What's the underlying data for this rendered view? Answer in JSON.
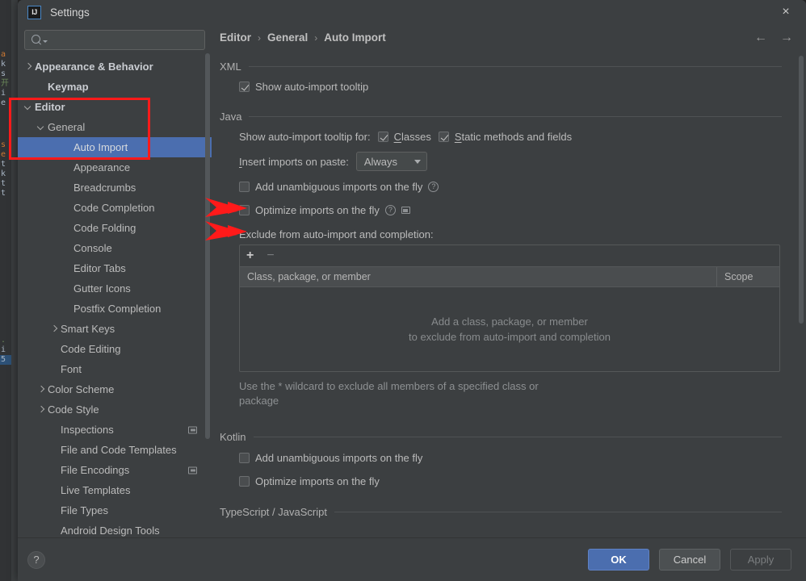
{
  "window": {
    "title": "Settings",
    "app_icon": "intellij-idea-icon",
    "close_icon": "×"
  },
  "search": {
    "value": "",
    "placeholder": "",
    "icon": "search-icon"
  },
  "sidebar": {
    "items": [
      {
        "label": "Appearance & Behavior",
        "indent": 0,
        "twisty": "right",
        "bold": true,
        "selected": false,
        "project_icon": false
      },
      {
        "label": "Keymap",
        "indent": 1,
        "twisty": "none",
        "bold": true,
        "selected": false,
        "project_icon": false
      },
      {
        "label": "Editor",
        "indent": 0,
        "twisty": "down",
        "bold": true,
        "selected": false,
        "project_icon": false
      },
      {
        "label": "General",
        "indent": 1,
        "twisty": "down",
        "bold": false,
        "selected": false,
        "project_icon": false
      },
      {
        "label": "Auto Import",
        "indent": 3,
        "twisty": "none",
        "bold": false,
        "selected": true,
        "project_icon": false
      },
      {
        "label": "Appearance",
        "indent": 3,
        "twisty": "none",
        "bold": false,
        "selected": false,
        "project_icon": false
      },
      {
        "label": "Breadcrumbs",
        "indent": 3,
        "twisty": "none",
        "bold": false,
        "selected": false,
        "project_icon": false
      },
      {
        "label": "Code Completion",
        "indent": 3,
        "twisty": "none",
        "bold": false,
        "selected": false,
        "project_icon": false
      },
      {
        "label": "Code Folding",
        "indent": 3,
        "twisty": "none",
        "bold": false,
        "selected": false,
        "project_icon": false
      },
      {
        "label": "Console",
        "indent": 3,
        "twisty": "none",
        "bold": false,
        "selected": false,
        "project_icon": false
      },
      {
        "label": "Editor Tabs",
        "indent": 3,
        "twisty": "none",
        "bold": false,
        "selected": false,
        "project_icon": false
      },
      {
        "label": "Gutter Icons",
        "indent": 3,
        "twisty": "none",
        "bold": false,
        "selected": false,
        "project_icon": false
      },
      {
        "label": "Postfix Completion",
        "indent": 3,
        "twisty": "none",
        "bold": false,
        "selected": false,
        "project_icon": false
      },
      {
        "label": "Smart Keys",
        "indent": 2,
        "twisty": "right",
        "bold": false,
        "selected": false,
        "project_icon": false
      },
      {
        "label": "Code Editing",
        "indent": 2,
        "twisty": "none",
        "bold": false,
        "selected": false,
        "project_icon": false
      },
      {
        "label": "Font",
        "indent": 2,
        "twisty": "none",
        "bold": false,
        "selected": false,
        "project_icon": false
      },
      {
        "label": "Color Scheme",
        "indent": 1,
        "twisty": "right",
        "bold": false,
        "selected": false,
        "project_icon": false
      },
      {
        "label": "Code Style",
        "indent": 1,
        "twisty": "right",
        "bold": false,
        "selected": false,
        "project_icon": false
      },
      {
        "label": "Inspections",
        "indent": 2,
        "twisty": "none",
        "bold": false,
        "selected": false,
        "project_icon": true
      },
      {
        "label": "File and Code Templates",
        "indent": 2,
        "twisty": "none",
        "bold": false,
        "selected": false,
        "project_icon": false
      },
      {
        "label": "File Encodings",
        "indent": 2,
        "twisty": "none",
        "bold": false,
        "selected": false,
        "project_icon": true
      },
      {
        "label": "Live Templates",
        "indent": 2,
        "twisty": "none",
        "bold": false,
        "selected": false,
        "project_icon": false
      },
      {
        "label": "File Types",
        "indent": 2,
        "twisty": "none",
        "bold": false,
        "selected": false,
        "project_icon": false
      },
      {
        "label": "Android Design Tools",
        "indent": 2,
        "twisty": "none",
        "bold": false,
        "selected": false,
        "project_icon": false
      }
    ]
  },
  "breadcrumb": {
    "parts": [
      "Editor",
      "General",
      "Auto Import"
    ],
    "separator": "›",
    "back_icon": "←",
    "forward_icon": "→"
  },
  "sections": {
    "xml": {
      "title": "XML",
      "show_tooltip": {
        "label": "Show auto-import tooltip",
        "checked": true
      }
    },
    "java": {
      "title": "Java",
      "tooltip_for_label": "Show auto-import tooltip for:",
      "classes": {
        "label": "Classes",
        "mnemonic": "C",
        "checked": true
      },
      "static_methods": {
        "label": "Static methods and fields",
        "mnemonic": "S",
        "checked": true
      },
      "insert_imports_label": "Insert imports on paste:",
      "insert_imports_mnemonic": "I",
      "insert_imports_value": "Always",
      "add_unambiguous": {
        "label": "Add unambiguous imports on the fly",
        "checked": false,
        "help": "?"
      },
      "optimize": {
        "label": "Optimize imports on the fly",
        "checked": false,
        "help": "?",
        "project_icon": true
      },
      "exclude_label": "Exclude from auto-import and completion:",
      "table": {
        "add_icon": "+",
        "remove_icon": "−",
        "columns": [
          "Class, package, or member",
          "Scope"
        ],
        "rows": [],
        "empty_line1": "Add a class, package, or member",
        "empty_line2": "to exclude from auto-import and completion"
      },
      "note": "Use the * wildcard to exclude all members of a specified class or package"
    },
    "kotlin": {
      "title": "Kotlin",
      "add_unambiguous": {
        "label": "Add unambiguous imports on the fly",
        "checked": false
      },
      "optimize": {
        "label": "Optimize imports on the fly",
        "checked": false
      }
    },
    "typescript": {
      "title": "TypeScript / JavaScript"
    }
  },
  "footer": {
    "help_icon": "?",
    "ok": "OK",
    "cancel": "Cancel",
    "apply": "Apply"
  },
  "colors": {
    "accent": "#4b6eaf",
    "annotation": "#ff1a1a",
    "dialog_bg": "#3c3f41"
  },
  "background_code": [
    "a",
    "k",
    "s",
    "开",
    "i",
    "e",
    "s",
    "e",
    "t",
    "k",
    "t",
    "t",
    "i",
    "5"
  ]
}
